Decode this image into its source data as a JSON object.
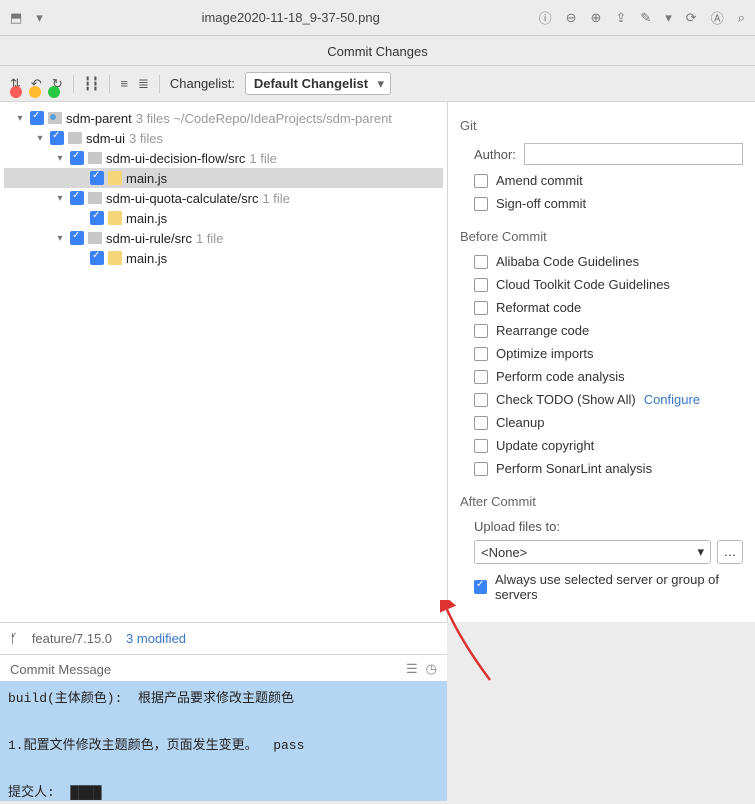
{
  "titlebar": {
    "sidebar_icon": "⬒",
    "dropdown": "▾",
    "filename": "image2020-11-18_9-37-50.png"
  },
  "dialog_title": "Commit Changes",
  "toolbar": {
    "changelist_label": "Changelist:",
    "changelist_value": "Default Changelist"
  },
  "tree": [
    {
      "indent": 0,
      "arrow": "▾",
      "chk": true,
      "icon": "mod",
      "label": "sdm-parent",
      "meta": "3 files  ~/CodeRepo/IdeaProjects/sdm-parent"
    },
    {
      "indent": 1,
      "arrow": "▾",
      "chk": true,
      "icon": "folder",
      "label": "sdm-ui",
      "meta": "3 files"
    },
    {
      "indent": 2,
      "arrow": "▾",
      "chk": true,
      "icon": "folder",
      "label": "sdm-ui-decision-flow/src",
      "meta": "1 file"
    },
    {
      "indent": 3,
      "arrow": "",
      "chk": true,
      "icon": "file",
      "label": "main.js",
      "meta": "",
      "sel": true
    },
    {
      "indent": 2,
      "arrow": "▾",
      "chk": true,
      "icon": "folder",
      "label": "sdm-ui-quota-calculate/src",
      "meta": "1 file"
    },
    {
      "indent": 3,
      "arrow": "",
      "chk": true,
      "icon": "file",
      "label": "main.js",
      "meta": ""
    },
    {
      "indent": 2,
      "arrow": "▾",
      "chk": true,
      "icon": "folder",
      "label": "sdm-ui-rule/src",
      "meta": "1 file"
    },
    {
      "indent": 3,
      "arrow": "",
      "chk": true,
      "icon": "file",
      "label": "main.js",
      "meta": ""
    }
  ],
  "right": {
    "git": "Git",
    "author_label": "Author:",
    "amend": "Amend commit",
    "signoff": "Sign-off commit",
    "before": "Before Commit",
    "opts": [
      "Alibaba Code Guidelines",
      "Cloud Toolkit Code Guidelines",
      "Reformat code",
      "Rearrange code",
      "Optimize imports",
      "Perform code analysis",
      "Check TODO (Show All)",
      "Cleanup",
      "Update copyright",
      "Perform SonarLint analysis"
    ],
    "configure": "Configure",
    "after": "After Commit",
    "upload_label": "Upload files to:",
    "upload_value": "<None>",
    "always": "Always use selected server or group of servers"
  },
  "status": {
    "branch_icon": "ᚶ",
    "branch": "feature/7.15.0",
    "modified": "3 modified"
  },
  "commit_msg": {
    "header": "Commit Message",
    "text": "build(主体颜色):  根据产品要求修改主题颜色\n\n1.配置文件修改主题颜色，页面发生变更。  pass\n\n提交人:  ████"
  }
}
